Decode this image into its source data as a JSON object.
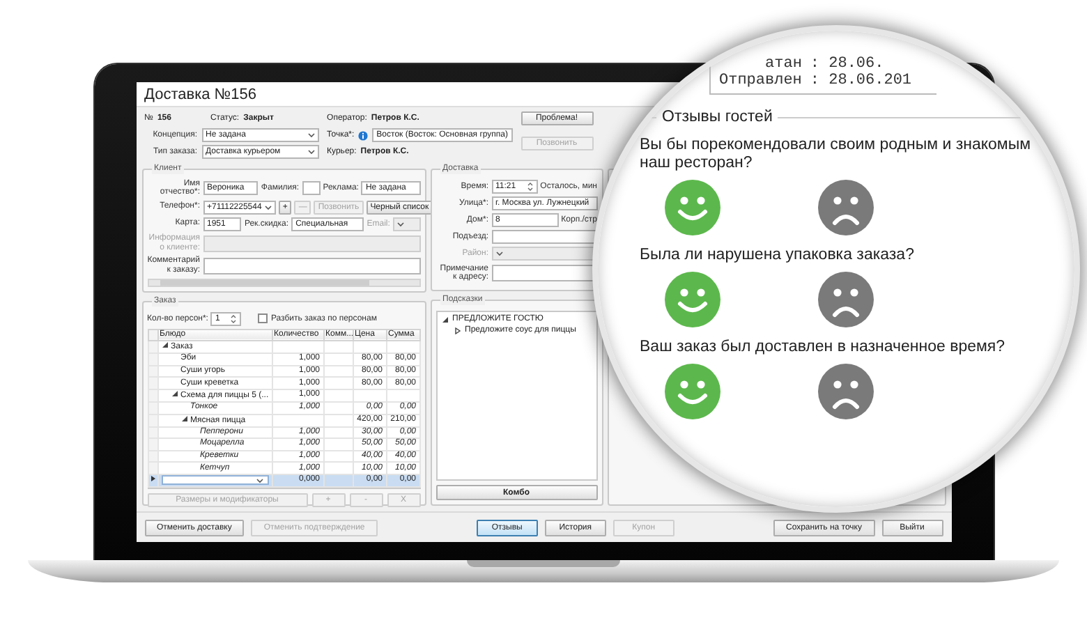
{
  "window": {
    "title": "Доставка №156"
  },
  "header": {
    "number_label": "№",
    "number": "156",
    "status_label": "Статус:",
    "status": "Закрыт",
    "operator_label": "Оператор:",
    "operator": "Петров К.С.",
    "courier_label": "Курьер:",
    "courier": "Петров К.С.",
    "concept": {
      "label": "Концепция:",
      "value": "Не задана"
    },
    "order_type": {
      "label": "Тип заказа:",
      "value": "Доставка курьером"
    },
    "point": {
      "label": "Точка*:",
      "value": "Восток (Восток: Основная группа)"
    },
    "buttons": [
      {
        "label": "Проблема!",
        "disabled": false
      },
      {
        "label": "Позвонить",
        "disabled": true
      }
    ]
  },
  "client": {
    "title": "Клиент",
    "rows": [
      {
        "fields": [
          {
            "kind": "field",
            "label": "Имя отчество*:",
            "value": "Вероника",
            "disabled": false
          },
          {
            "kind": "field",
            "label": "Фамилия:",
            "disabled": false
          },
          {
            "kind": "field",
            "label": "Реклама:",
            "value": "Не задана",
            "disabled": false
          }
        ]
      },
      {
        "fields": [
          {
            "kind": "select",
            "label": "Телефон*:",
            "value": "+71112225544",
            "disabled": false
          },
          {
            "kind": "button",
            "label": "+",
            "disabled": false
          },
          {
            "kind": "button",
            "label": "—",
            "disabled": true
          },
          {
            "kind": "button",
            "label": "Позвонить",
            "disabled": true
          },
          {
            "kind": "button",
            "label": "Черный список",
            "disabled": false
          }
        ]
      },
      {
        "fields": [
          {
            "kind": "field",
            "label": "Карта:",
            "value": "1951",
            "disabled": false
          },
          {
            "kind": "field",
            "label": "Рек.скидка:",
            "value": "Специальная",
            "disabled": false
          },
          {
            "kind": "select",
            "label": "Email:",
            "disabled": true
          }
        ]
      },
      {
        "fields": [
          {
            "kind": "area",
            "label": "Информация о клиенте:",
            "disabled": true
          }
        ]
      },
      {
        "fields": [
          {
            "kind": "area",
            "label": "Комментарий к заказу:",
            "disabled": false
          }
        ]
      }
    ]
  },
  "delivery": {
    "title": "Доставка",
    "rows": [
      {
        "fields": [
          {
            "kind": "spin",
            "label": "Время:",
            "value": "11:21",
            "disabled": false
          },
          {
            "kind": "label",
            "label": "Осталось, мин",
            "disabled": false
          }
        ]
      },
      {
        "fields": [
          {
            "kind": "field",
            "label": "Улица*:",
            "value": "г. Москва ул. Лужнецкий",
            "disabled": false
          }
        ]
      },
      {
        "fields": [
          {
            "kind": "field",
            "label": "Дом*:",
            "value": "8",
            "disabled": false
          },
          {
            "kind": "label",
            "label": "Корп./стр",
            "disabled": false
          }
        ]
      },
      {
        "fields": [
          {
            "kind": "field",
            "label": "Подъезд:",
            "disabled": false
          }
        ]
      },
      {
        "fields": [
          {
            "kind": "select",
            "label": "Район:",
            "disabled": true
          }
        ]
      },
      {
        "fields": [
          {
            "kind": "area",
            "label": "Примечание к адресу:",
            "disabled": false
          }
        ]
      }
    ]
  },
  "order": {
    "title": "Заказ",
    "persons": {
      "label": "Кол-во персон*:",
      "value": "1"
    },
    "split": {
      "label": "Разбить заказ по персонам",
      "checked": false
    },
    "columns": [
      "Блюдо",
      "Количество",
      "Комм...",
      "Цена",
      "Сумма"
    ],
    "rows": [
      {
        "kind": "group",
        "dish": "Заказ",
        "expanded": true,
        "selected": false,
        "children": [
          {
            "kind": "item",
            "dish": "Эби",
            "quantity": "1,000",
            "price": "80,00",
            "sum": "80,00",
            "selected": false
          },
          {
            "kind": "item",
            "dish": "Суши угорь",
            "quantity": "1,000",
            "price": "80,00",
            "sum": "80,00",
            "selected": false
          },
          {
            "kind": "item",
            "dish": "Суши креветка",
            "quantity": "1,000",
            "price": "80,00",
            "sum": "80,00",
            "selected": false
          },
          {
            "kind": "group",
            "dish": "Схема для пиццы 5 (...",
            "quantity": "1,000",
            "expanded": true,
            "selected": false,
            "children": [
              {
                "kind": "modifier",
                "dish": "Тонкое",
                "quantity": "1,000",
                "price": "0,00",
                "sum": "0,00",
                "selected": false
              },
              {
                "kind": "group",
                "dish": "Мясная пицца",
                "price": "420,00",
                "sum": "210,00",
                "expanded": true,
                "selected": false,
                "children": [
                  {
                    "kind": "modifier",
                    "dish": "Пепперони",
                    "quantity": "1,000",
                    "price": "30,00",
                    "sum": "0,00",
                    "selected": false
                  },
                  {
                    "kind": "modifier",
                    "dish": "Моцарелла",
                    "quantity": "1,000",
                    "price": "50,00",
                    "sum": "50,00",
                    "selected": false
                  },
                  {
                    "kind": "modifier",
                    "dish": "Креветки",
                    "quantity": "1,000",
                    "price": "40,00",
                    "sum": "40,00",
                    "selected": false
                  },
                  {
                    "kind": "modifier",
                    "dish": "Кетчуп",
                    "quantity": "1,000",
                    "price": "10,00",
                    "sum": "10,00",
                    "selected": false
                  }
                ]
              }
            ]
          }
        ]
      },
      {
        "kind": "new",
        "quantity": "0,000",
        "price": "0,00",
        "sum": "0,00",
        "selected": true
      }
    ],
    "buttons": [
      {
        "label": "Размеры и модификаторы",
        "disabled": true
      },
      {
        "label": "+",
        "disabled": true
      },
      {
        "label": "-",
        "disabled": true
      },
      {
        "label": "X",
        "disabled": true
      }
    ]
  },
  "hints": {
    "title": "Подсказки",
    "items": [
      {
        "text": "ПРЕДЛОЖИТЕ ГОСТЮ",
        "expanded": true,
        "children": [
          {
            "text": "Предложите соус для пиццы",
            "expanded": false
          }
        ]
      }
    ],
    "button": "Комбо"
  },
  "footer": {
    "left": [
      {
        "label": "Отменить доставку",
        "disabled": false,
        "selected": false
      },
      {
        "label": "Отменить подтверждение",
        "disabled": true,
        "selected": false
      }
    ],
    "center": [
      {
        "label": "Отзывы",
        "disabled": false,
        "selected": true
      },
      {
        "label": "История",
        "disabled": false,
        "selected": false
      },
      {
        "label": "Купон",
        "disabled": true,
        "selected": false
      }
    ],
    "right": [
      {
        "label": "Сохранить на точку",
        "disabled": false,
        "selected": false
      },
      {
        "label": "Выйти",
        "disabled": false,
        "selected": false
      }
    ]
  },
  "lens": {
    "record": [
      {
        "label": "атан",
        "value": ": 28.06."
      },
      {
        "label": "Отправлен",
        "value": ": 28.06.201"
      }
    ],
    "feedback": {
      "title": "Отзывы гостей",
      "questions": [
        {
          "text": "Вы бы порекомендовали своим родным и знакомым наш ресторан?",
          "options": [
            {
              "kind": "happy",
              "selected": true
            },
            {
              "kind": "sad",
              "selected": false
            }
          ]
        },
        {
          "text": "Была ли нарушена упаковка заказа?",
          "options": [
            {
              "kind": "happy",
              "selected": true
            },
            {
              "kind": "sad",
              "selected": false
            }
          ]
        },
        {
          "text": "Ваш заказ был доставлен в назначенное время?",
          "options": [
            {
              "kind": "happy",
              "selected": true
            },
            {
              "kind": "sad",
              "selected": false
            }
          ]
        }
      ]
    }
  }
}
